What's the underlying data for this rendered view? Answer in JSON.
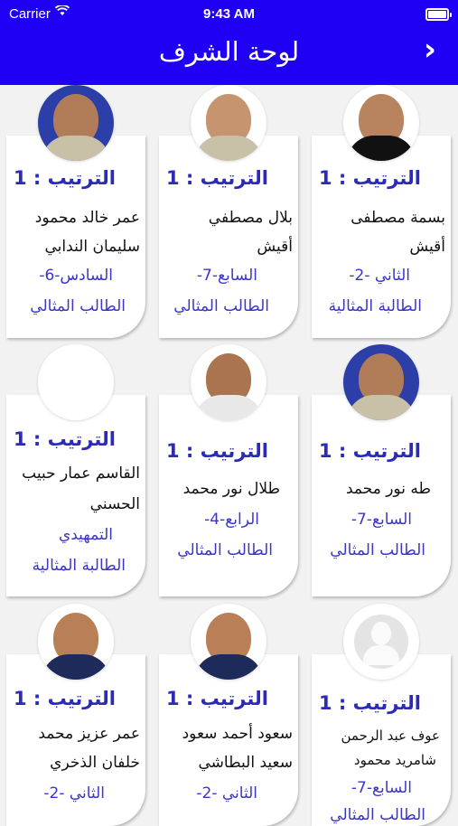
{
  "status_bar": {
    "carrier": "Carrier",
    "time": "9:43 AM"
  },
  "header": {
    "title": "لوحة الشرف",
    "back_glyph": "›"
  },
  "colors": {
    "header_bg": "#1f00f5",
    "rank_text": "#2b2bb6",
    "info_text": "#3a36c8"
  },
  "cards": [
    {
      "rank": "الترتيب : 1",
      "name_line1": "بسمة مصطفى",
      "name_line2": "أقيش",
      "grade": "الثاني -2-",
      "award": "الطالبة المثالية"
    },
    {
      "rank": "الترتيب : 1",
      "name_line1": "بلال مصطفي",
      "name_line2": "أقيش",
      "grade": "السابع-7-",
      "award": "الطالب المثالي"
    },
    {
      "rank": "الترتيب : 1",
      "name_line1": "عمر خالد محمود",
      "name_line2": "سليمان الندابي",
      "grade": "السادس-6-",
      "award": "الطالب المثالي"
    },
    {
      "rank": "الترتيب : 1",
      "name_line1": "طه نور محمد",
      "grade": "السابع-7-",
      "award": "الطالب المثالي"
    },
    {
      "rank": "الترتيب : 1",
      "name_line1": "طلال نور محمد",
      "grade": "الرابع-4-",
      "award": "الطالب المثالي"
    },
    {
      "rank": "الترتيب : 1",
      "name_line1": "القاسم عمار حبيب",
      "name_line2": "الحسني",
      "grade": "التمهيدي",
      "award": "الطالبة المثالية"
    },
    {
      "rank": "الترتيب : 1",
      "name_line1": "عوف عبد الرحمن",
      "name_line2": "شامريد محمود",
      "grade": "السابع-7-",
      "award": "الطالب المثالي"
    },
    {
      "rank": "الترتيب : 1",
      "name_line1": "سعود أحمد سعود",
      "name_line2": "سعيد البطاشي",
      "grade": "الثاني -2-"
    },
    {
      "rank": "الترتيب : 1",
      "name_line1": "عمر عزيز محمد",
      "name_line2": "خلفان الذخري",
      "grade": "الثاني -2-"
    }
  ]
}
